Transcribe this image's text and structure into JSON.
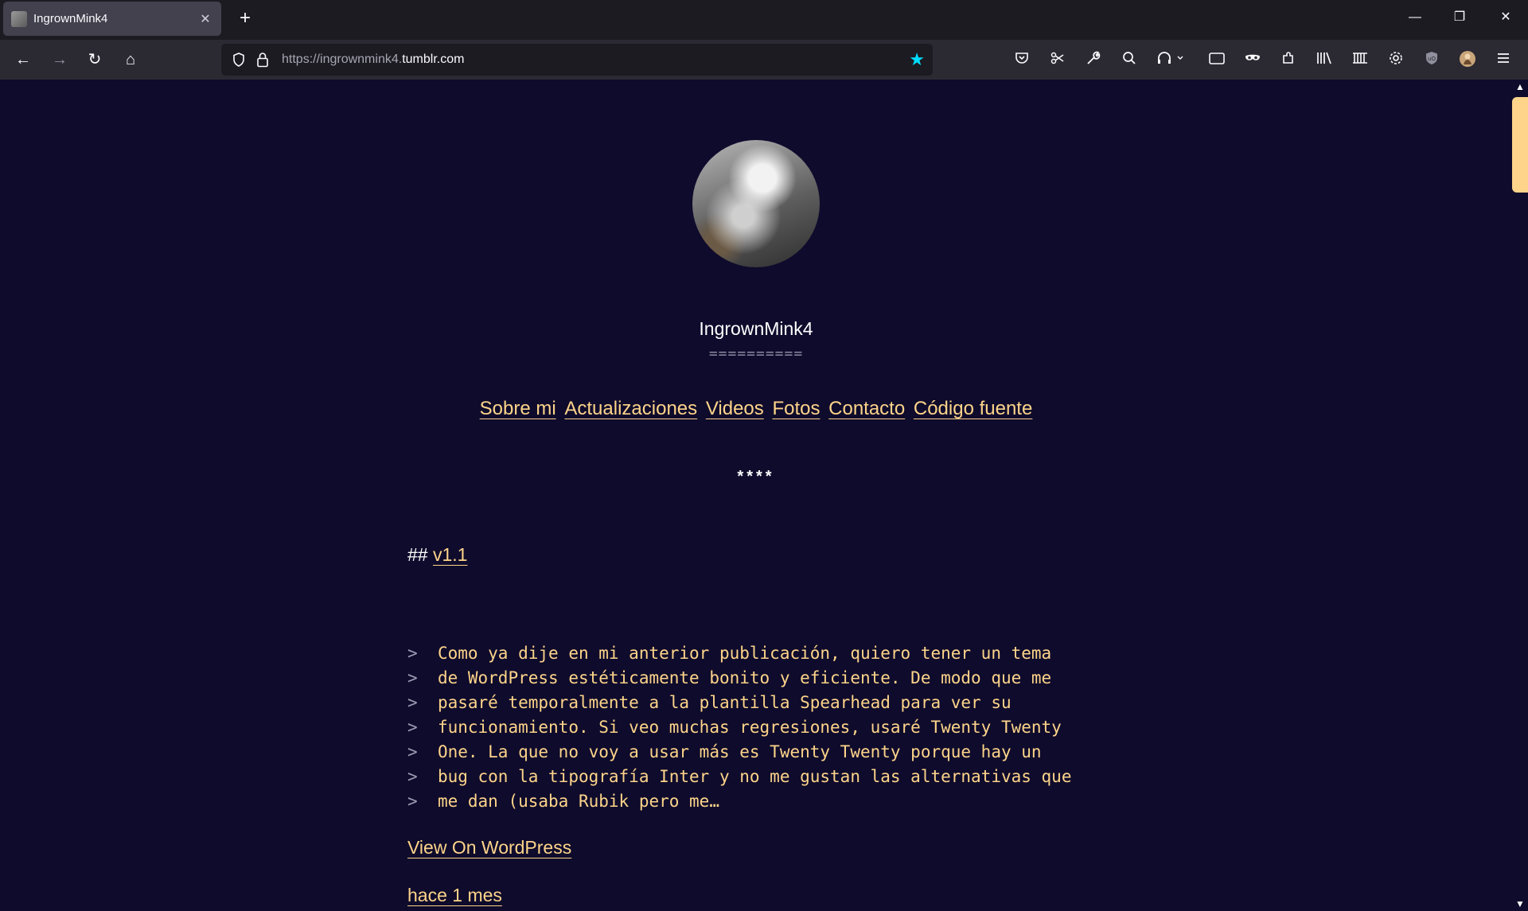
{
  "browser": {
    "tab": {
      "title": "IngrownMink4",
      "close_icon": "✕"
    },
    "new_tab_icon": "+",
    "window_controls": {
      "minimize": "—",
      "restore": "❐",
      "close": "✕"
    },
    "nav": {
      "back": "←",
      "forward": "→",
      "reload": "↻",
      "home": "⌂"
    },
    "url": {
      "prefix": "https://ingrownmink4.",
      "domain": "tumblr.com"
    },
    "bookmark_star": "★",
    "accent_color": "#00ddff",
    "toolbar_icons": [
      "pocket-icon",
      "screenshot-icon",
      "wrench-icon",
      "search-icon",
      "headphones-icon",
      "reader-view-icon",
      "private-mask-icon",
      "extensions-icon",
      "library-icon",
      "sidebar-icon",
      "settings-icon",
      "ublock-icon",
      "profile-avatar",
      "hamburger-menu-icon"
    ]
  },
  "page": {
    "background_color": "#0f0b2c",
    "link_color": "#fdd48a",
    "blog_title": "IngrownMink4",
    "title_rule": "==========",
    "nav_links": [
      "Sobre mi",
      "Actualizaciones",
      "Videos",
      "Fotos",
      "Contacto",
      "Código fuente"
    ],
    "separator": "****",
    "post": {
      "heading_prefix": "##",
      "heading_link": "v1.1",
      "quote_marker": ">",
      "quote_lines": [
        "Como ya dije en mi anterior publicación, quiero tener un tema",
        "de WordPress estéticamente bonito y eficiente. De modo que me",
        "pasaré temporalmente a la plantilla Spearhead para ver su",
        "funcionamiento. Si veo muchas regresiones, usaré Twenty Twenty",
        "One. La que no voy a usar más es Twenty Twenty porque hay un",
        "bug con la tipografía Inter y no me gustan las alternativas que",
        "me dan (usaba Rubik pero me…"
      ],
      "view_link": "View On WordPress",
      "date_link": "hace 1 mes"
    }
  }
}
